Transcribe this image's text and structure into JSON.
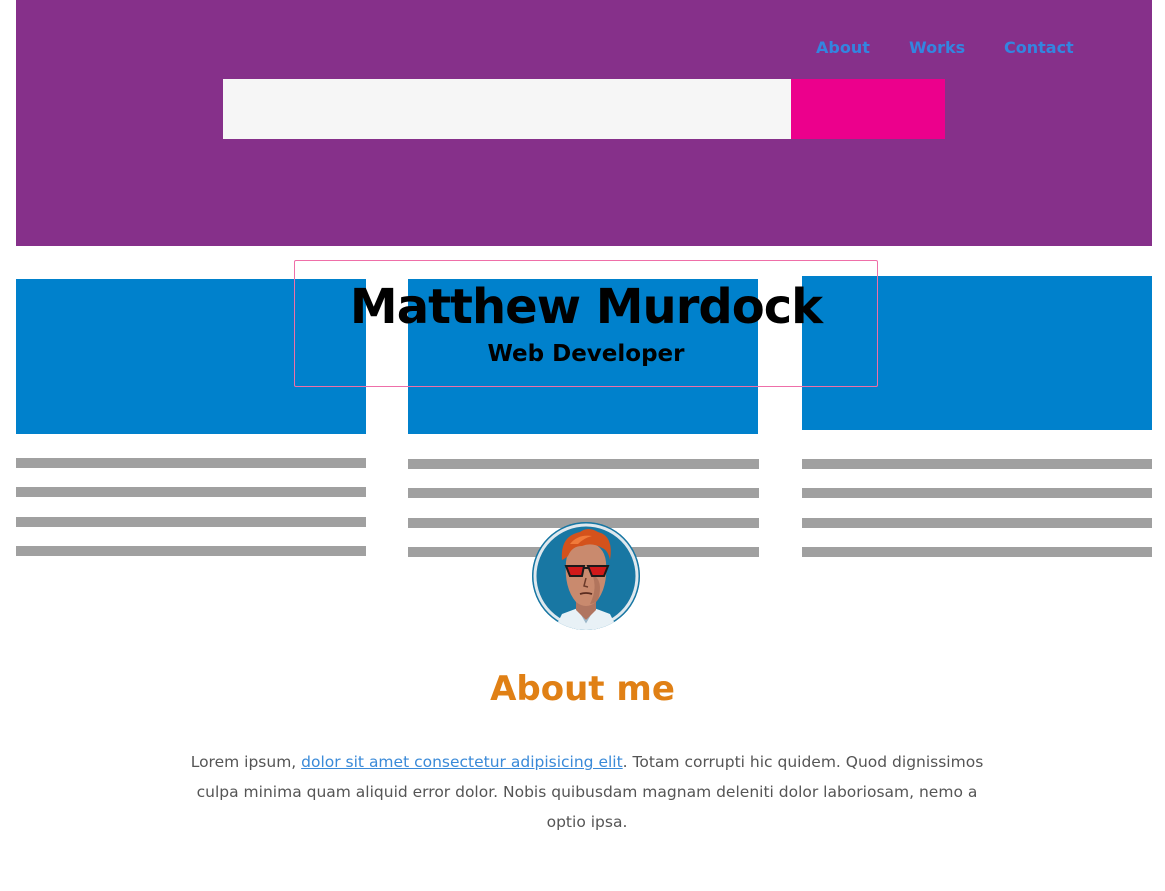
{
  "header": {
    "background": "#86308a",
    "nav": {
      "about": "About",
      "works": "Works",
      "contact": "Contact",
      "link_color": "#3385e0"
    },
    "search": {
      "value": "",
      "button_color": "#ec008c"
    }
  },
  "hero": {
    "name": "Matthew Murdock",
    "role": "Web Developer"
  },
  "columns": {
    "block_color": "#0081cc",
    "line_color": "#a0a0a0"
  },
  "avatar": {
    "icon": "avatar-icon"
  },
  "about": {
    "title": "About me",
    "title_color": "#e08015",
    "text_before": "Lorem ipsum, ",
    "link_text": "dolor sit amet consectetur adipisicing elit",
    "text_after": ". Totam corrupti hic quidem. Quod dignissimos culpa minima quam aliquid error dolor. Nobis quibusdam magnam deleniti dolor laboriosam, nemo a optio ipsa."
  }
}
